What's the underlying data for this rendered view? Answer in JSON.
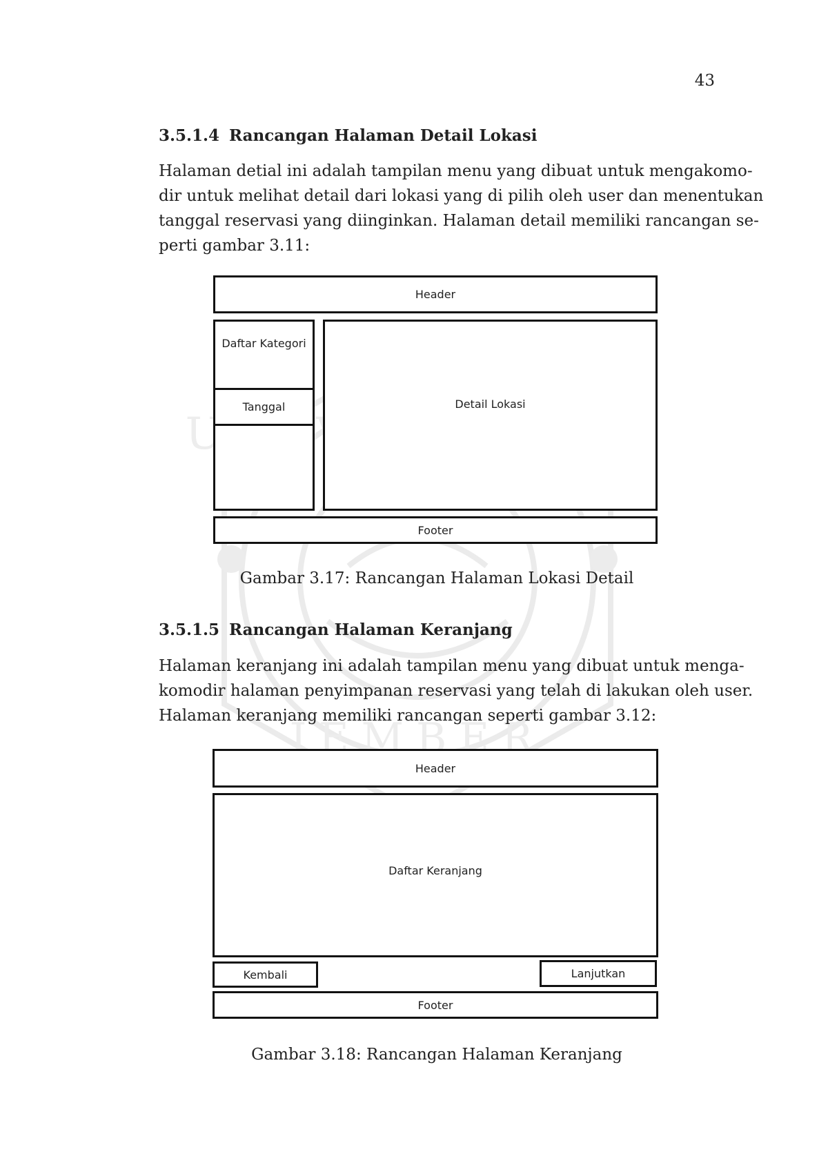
{
  "page_number": "43",
  "section1": {
    "number": "3.5.1.4",
    "title": "Rancangan Halaman Detail Lokasi",
    "paragraph_lines": [
      "Halaman detial ini adalah tampilan menu yang dibuat untuk mengakomo-",
      "dir untuk melihat detail dari lokasi yang di pilih oleh user dan menentukan",
      "tanggal reservasi yang diinginkan.  Halaman detail memiliki rancangan se-",
      "perti gambar 3.11:"
    ],
    "figure": {
      "header": "Header",
      "daftar_kategori": "Daftar Kategori",
      "tanggal": "Tanggal",
      "detail_lokasi": "Detail Lokasi",
      "footer": "Footer"
    },
    "caption": "Gambar 3.17:  Rancangan Halaman Lokasi Detail"
  },
  "section2": {
    "number": "3.5.1.5",
    "title": "Rancangan Halaman Keranjang",
    "paragraph_lines": [
      "Halaman keranjang ini adalah tampilan menu yang dibuat untuk menga-",
      "komodir halaman penyimpanan reservasi yang telah di lakukan oleh user.",
      "Halaman keranjang memiliki rancangan seperti gambar 3.12:"
    ],
    "figure": {
      "header": "Header",
      "daftar_keranjang": "Daftar Keranjang",
      "kembali": "Kembali",
      "lanjutkan": "Lanjutkan",
      "footer": "Footer"
    },
    "caption": "Gambar 3.18:  Rancangan Halaman Keranjang"
  },
  "watermark": {
    "text_top": "UNIVERSITAS",
    "text_bottom": "JEMBER",
    "icon": "university-seal-icon"
  }
}
